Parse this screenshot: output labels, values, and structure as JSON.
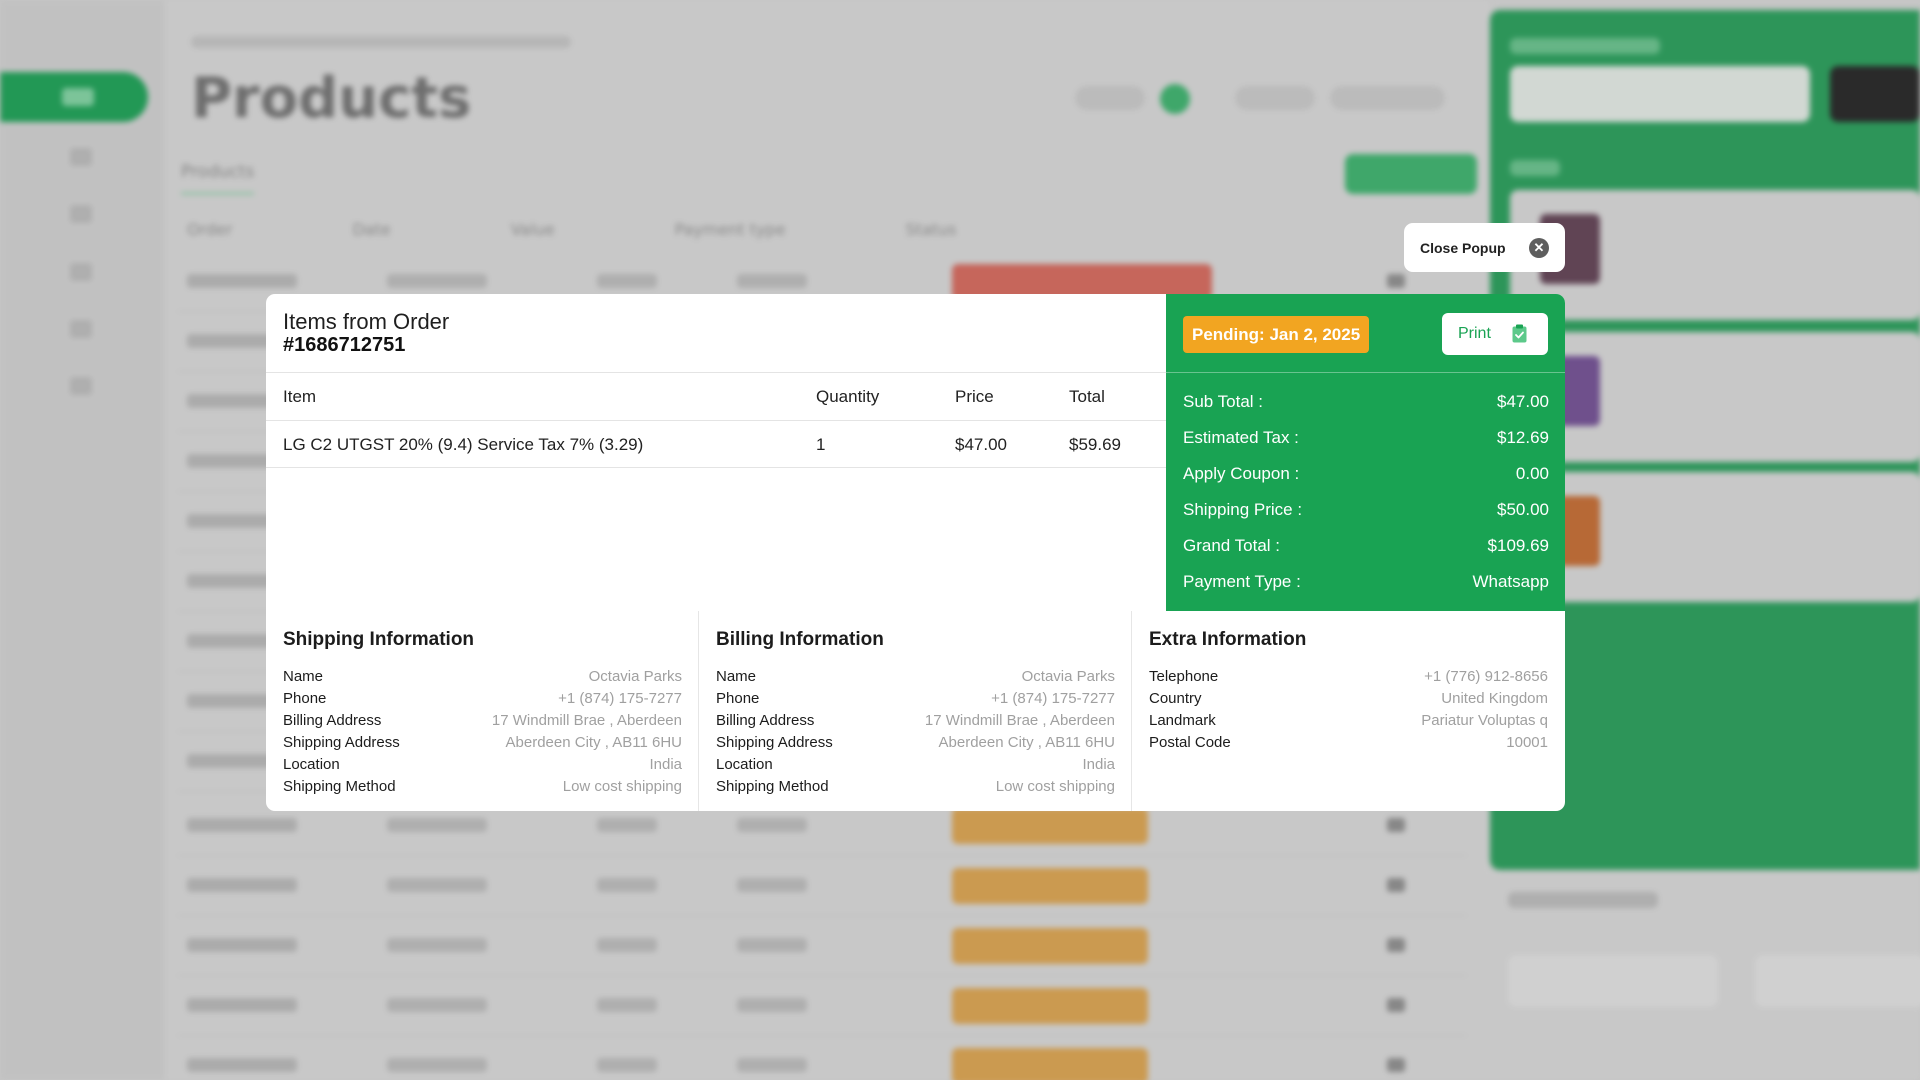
{
  "background": {
    "page_title": "Products",
    "tab_label": "Products",
    "table_headers": [
      "Order",
      "Date",
      "Value",
      "Payment type",
      "Status"
    ]
  },
  "close_popup_label": "Close Popup",
  "order": {
    "title": "Items from Order",
    "id": "#1686712751",
    "columns": {
      "item": "Item",
      "quantity": "Quantity",
      "price": "Price",
      "total": "Total"
    },
    "items": [
      {
        "item": "LG C2 UTGST 20% (9.4) Service Tax 7% (3.29)",
        "quantity": "1",
        "price": "$47.00",
        "total": "$59.69"
      }
    ]
  },
  "summary": {
    "status": "Pending: Jan 2, 2025",
    "print_label": "Print",
    "rows": [
      {
        "label": "Sub Total :",
        "value": "$47.00"
      },
      {
        "label": "Estimated Tax :",
        "value": "$12.69"
      },
      {
        "label": "Apply Coupon :",
        "value": "0.00"
      },
      {
        "label": "Shipping Price :",
        "value": "$50.00"
      },
      {
        "label": "Grand Total :",
        "value": "$109.69"
      },
      {
        "label": "Payment Type :",
        "value": "Whatsapp"
      }
    ]
  },
  "shipping": {
    "title": "Shipping Information",
    "rows": [
      {
        "label": "Name",
        "value": "Octavia Parks"
      },
      {
        "label": "Phone",
        "value": "+1 (874) 175-7277"
      },
      {
        "label": "Billing Address",
        "value": "17 Windmill Brae , Aberdeen"
      },
      {
        "label": "Shipping Address",
        "value": "Aberdeen City , AB11 6HU"
      },
      {
        "label": "Location",
        "value": "India"
      },
      {
        "label": "Shipping Method",
        "value": "Low cost shipping"
      }
    ]
  },
  "billing": {
    "title": "Billing Information",
    "rows": [
      {
        "label": "Name",
        "value": "Octavia Parks"
      },
      {
        "label": "Phone",
        "value": "+1 (874) 175-7277"
      },
      {
        "label": "Billing Address",
        "value": "17 Windmill Brae , Aberdeen"
      },
      {
        "label": "Shipping Address",
        "value": "Aberdeen City , AB11 6HU"
      },
      {
        "label": "Location",
        "value": "India"
      },
      {
        "label": "Shipping Method",
        "value": "Low cost shipping"
      }
    ]
  },
  "extra": {
    "title": "Extra Information",
    "rows": [
      {
        "label": "Telephone",
        "value": "+1 (776) 912-8656"
      },
      {
        "label": "Country",
        "value": "United Kingdom"
      },
      {
        "label": "Landmark",
        "value": "Pariatur Voluptas q"
      },
      {
        "label": "Postal Code",
        "value": "10001"
      }
    ]
  },
  "colors": {
    "accent": "#19a353",
    "pending": "#f2a521",
    "overlay": "#d9d9d9"
  },
  "icons": {
    "close": "close-icon",
    "print": "clipboard-check-icon"
  }
}
